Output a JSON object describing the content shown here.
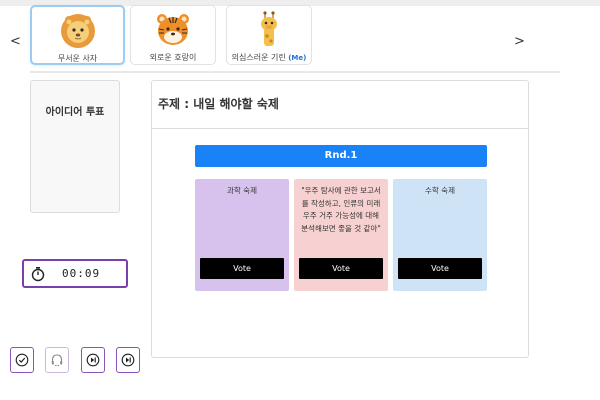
{
  "participants": [
    {
      "name": "무서운 사자",
      "avatar": "lion-avatar",
      "active": true
    },
    {
      "name": "외로운 호랑이",
      "avatar": "tiger-avatar",
      "active": false
    },
    {
      "name": "의심스러운 기린",
      "me_tag": "(Me)",
      "avatar": "giraffe-avatar",
      "active": false
    }
  ],
  "nav": {
    "prev_icon": "<",
    "next_icon": ">"
  },
  "sidebar": {
    "idea_vote_title": "아이디어 투표"
  },
  "timer": {
    "icon": "stopwatch-icon",
    "time": "00:09"
  },
  "controls": [
    {
      "icon": "check-circle-icon"
    },
    {
      "icon": "headset-icon"
    },
    {
      "icon": "skip-forward-icon"
    },
    {
      "icon": "skip-forward-icon"
    }
  ],
  "main": {
    "title": "주제 : 내일 해야할 숙제",
    "round": "Rnd.1",
    "options": [
      {
        "text": "과학 숙제",
        "vote_label": "Vote"
      },
      {
        "text": "\"우주 탐사에 관한 보고서를 작성하고, 인류의 미래 우주 거주 가능성에 대해 분석해보면 좋을 것 같아\"",
        "vote_label": "Vote"
      },
      {
        "text": "수학 숙제",
        "vote_label": "Vote"
      }
    ]
  },
  "colors": {
    "accent_blue": "#1a82f7",
    "timer_border": "#7a3fa8",
    "option_purple": "#d6c2ec",
    "option_pink": "#f7d1d1",
    "option_blue": "#cfe3f6",
    "vote_button": "#000000"
  }
}
